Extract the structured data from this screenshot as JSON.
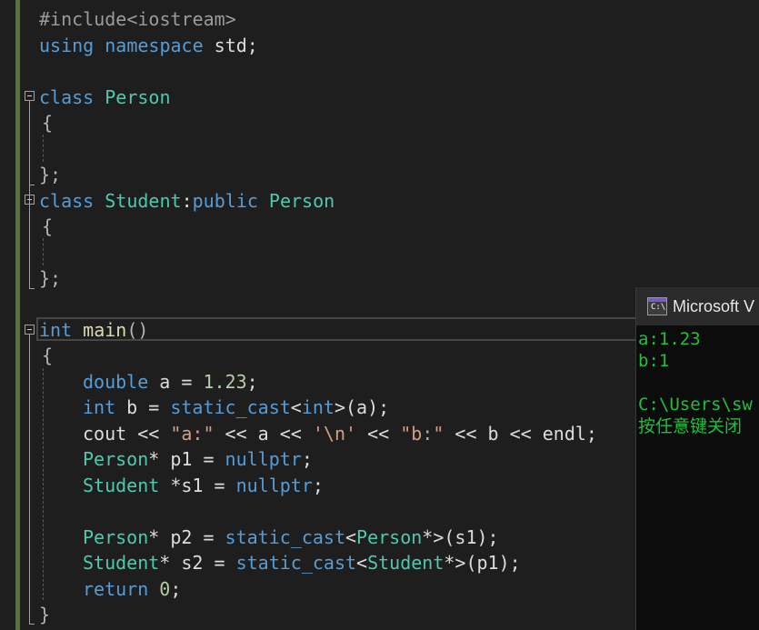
{
  "editor": {
    "lines": {
      "l1": "#include<iostream>",
      "l2_kw": "using",
      "l2_kw2": "namespace",
      "l2_rest": " std;",
      "l4_kw": "class",
      "l4_ty": "Person",
      "l5": "{",
      "l7": "};",
      "l8_kw": "class",
      "l8_ty": "Student",
      "l8_colon": ":",
      "l8_kw2": "public",
      "l8_ty2": "Person",
      "l9": "{",
      "l11": "};",
      "l13_kw": "int",
      "l13_fn": "main",
      "l13_p": "()",
      "l14": "{",
      "l15_kw": "double",
      "l15_rest": " a = ",
      "l15_nu": "1.23",
      "l15_end": ";",
      "l16_kw": "int",
      "l16_rest": " b = ",
      "l16_kw2": "static_cast",
      "l16_lt": "<",
      "l16_kw3": "int",
      "l16_end": ">(a);",
      "l17_a": "cout << ",
      "l17_s1": "\"a:\"",
      "l17_b": " << a << ",
      "l17_s2": "'\\n'",
      "l17_c": " << ",
      "l17_s3": "\"b:\"",
      "l17_d": " << b << endl;",
      "l18_ty": "Person",
      "l18_rest": "* p1 = ",
      "l18_kw": "nullptr",
      "l18_end": ";",
      "l19_ty": "Student",
      "l19_rest": " *s1 = ",
      "l19_kw": "nullptr",
      "l19_end": ";",
      "l21_ty": "Person",
      "l21_rest": "* p2 = ",
      "l21_kw": "static_cast",
      "l21_lt": "<",
      "l21_ty2": "Person",
      "l21_end": "*>(s1);",
      "l22_ty": "Student",
      "l22_rest": "* s2 = ",
      "l22_kw": "static_cast",
      "l22_lt": "<",
      "l22_ty2": "Student",
      "l22_end": "*>(p1);",
      "l23_kw": "return",
      "l23_sp": " ",
      "l23_nu": "0",
      "l23_end": ";",
      "l24": "}"
    }
  },
  "console": {
    "title": "Microsoft V",
    "icon_text": "C:\\",
    "output": {
      "line1": "a:1.23",
      "line2": "b:1",
      "line3": "",
      "line4": "C:\\Users\\sw",
      "line5": "按任意键关闭"
    }
  },
  "colors": {
    "background": "#1e1e1e",
    "keyword": "#569cd6",
    "type": "#4ec9b0",
    "function": "#dcdcaa",
    "string": "#d69d85",
    "number": "#b5cea8",
    "console_text": "#1fbf3c",
    "change_bar": "#55733a"
  }
}
